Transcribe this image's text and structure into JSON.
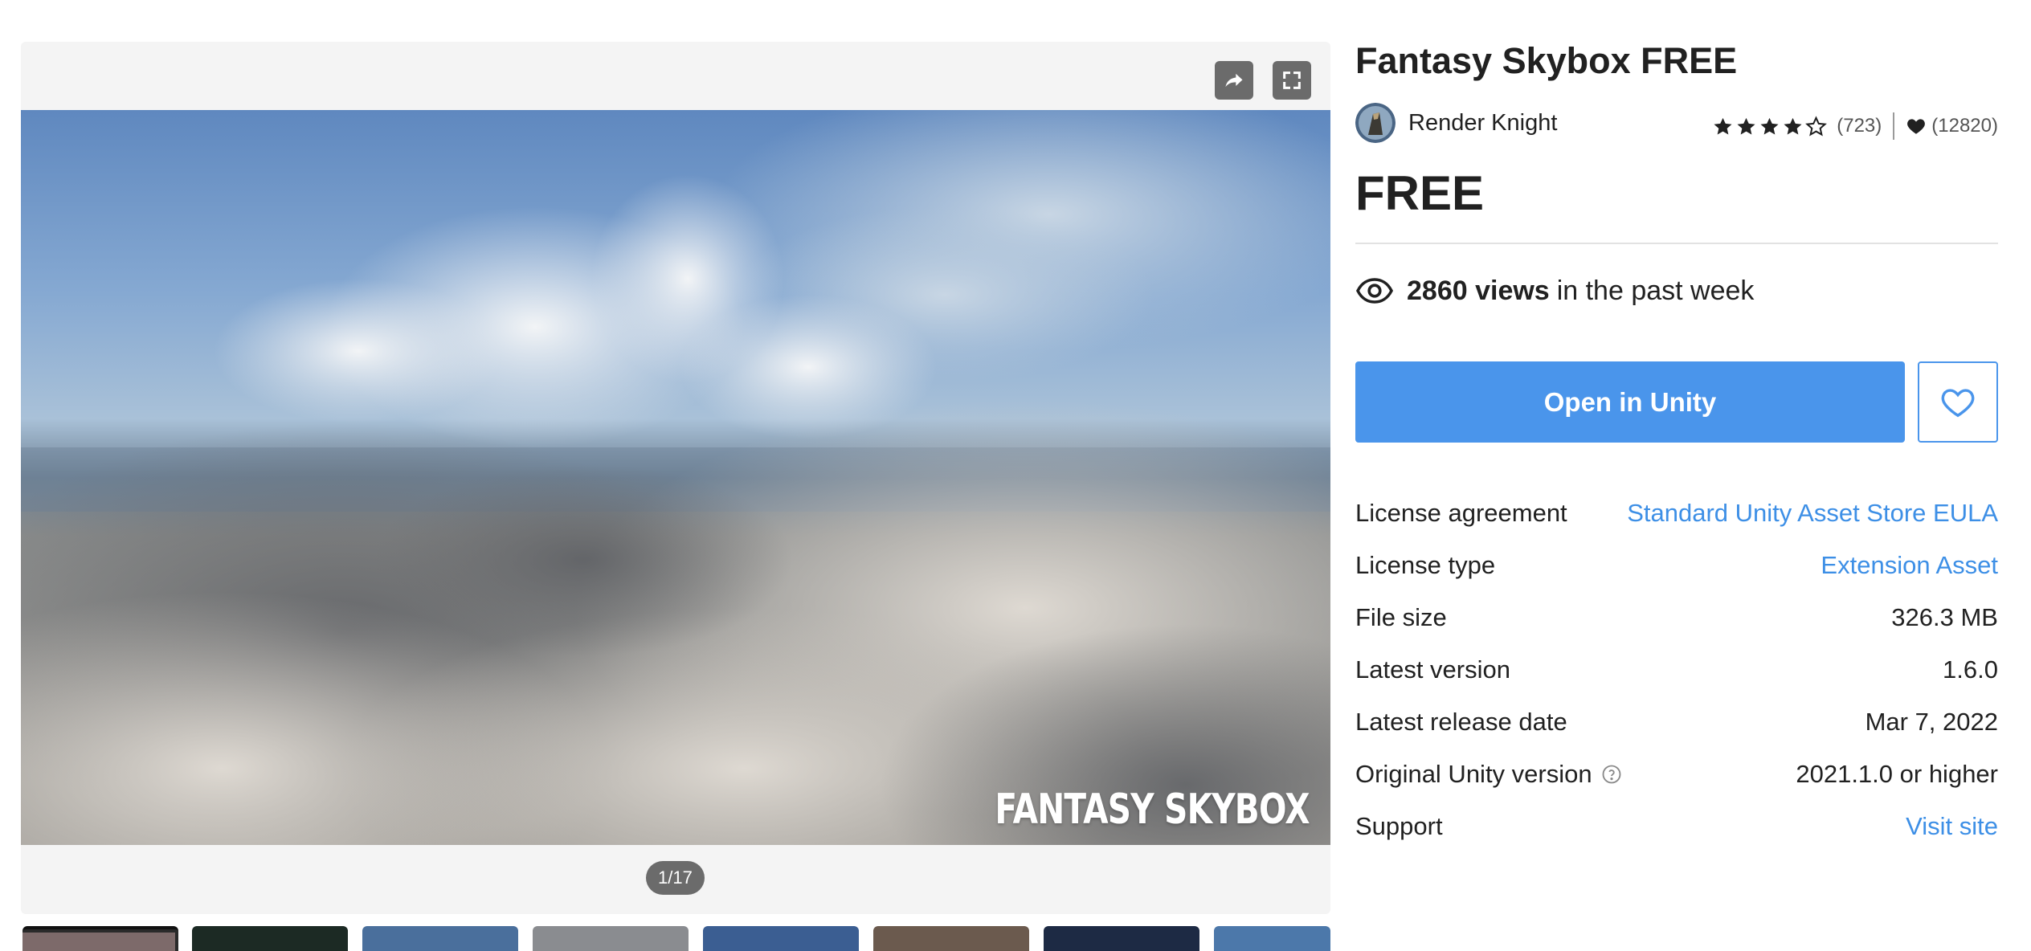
{
  "gallery": {
    "pager": "1/17",
    "watermark": "FANTASY SKYBOX",
    "thumbnail_count": 8
  },
  "asset": {
    "title": "Fantasy Skybox FREE",
    "publisher": "Render Knight",
    "rating_stars": 4,
    "rating_count": "(723)",
    "favorites_count": "(12820)",
    "price": "FREE"
  },
  "views": {
    "count": "2860 views",
    "suffix": "in the past week"
  },
  "actions": {
    "open_label": "Open in Unity"
  },
  "details": [
    {
      "label": "License agreement",
      "value": "Standard Unity Asset Store EULA",
      "link": true
    },
    {
      "label": "License type",
      "value": "Extension Asset",
      "link": true
    },
    {
      "label": "File size",
      "value": "326.3 MB",
      "link": false
    },
    {
      "label": "Latest version",
      "value": "1.6.0",
      "link": false
    },
    {
      "label": "Latest release date",
      "value": "Mar 7, 2022",
      "link": false
    },
    {
      "label": "Original Unity version",
      "value": "2021.1.0 or higher",
      "link": false,
      "help": true
    },
    {
      "label": "Support",
      "value": "Visit site",
      "link": true
    }
  ],
  "colors": {
    "accent": "#4a95eb",
    "link": "#3d8fe6",
    "gallery_bg": "#f4f4f4",
    "overlay_button": "#6b6b6b"
  },
  "icons": {
    "share": "share-icon",
    "fullscreen": "fullscreen-icon",
    "eye": "eye-icon",
    "heart": "heart-icon",
    "star": "star-icon",
    "help": "help-icon"
  }
}
